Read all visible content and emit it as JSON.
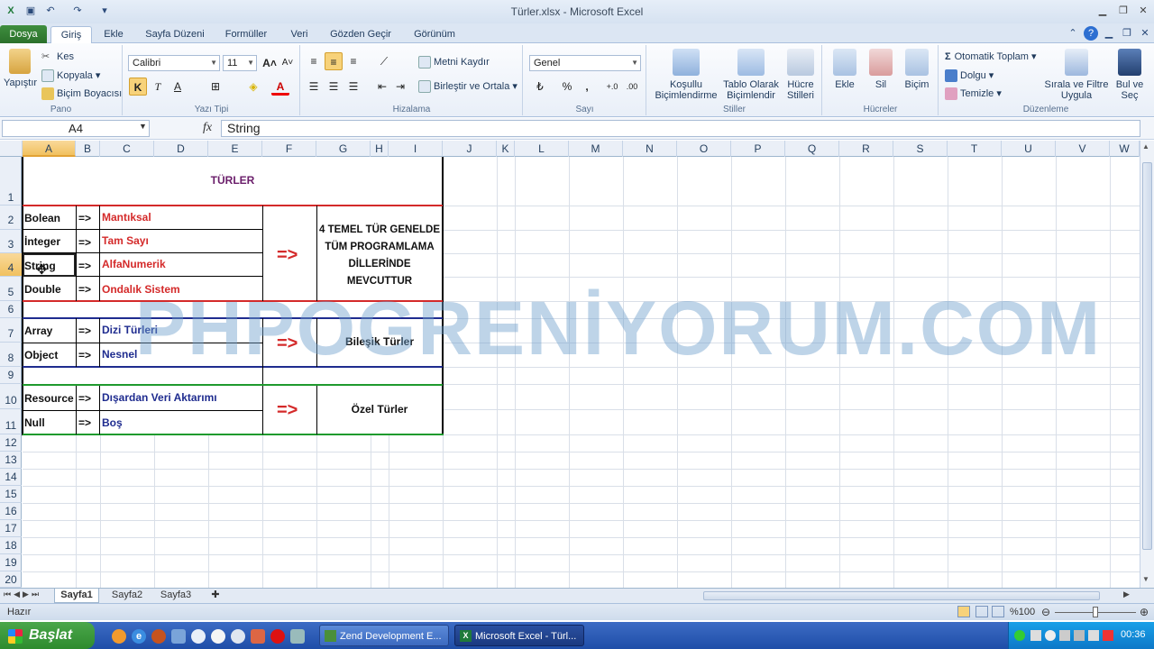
{
  "window": {
    "title": "Türler.xlsx - Microsoft Excel"
  },
  "ribbon_tabs": [
    "Dosya",
    "Giriş",
    "Ekle",
    "Sayfa Düzeni",
    "Formüller",
    "Veri",
    "Gözden Geçir",
    "Görünüm"
  ],
  "groups": {
    "pano": {
      "label": "Pano",
      "paste": "Yapıştır",
      "cut": "Kes",
      "copy": "Kopyala",
      "format_painter": "Biçim Boyacısı"
    },
    "font": {
      "label": "Yazı Tipi",
      "name": "Calibri",
      "size": "11",
      "bold": "K",
      "italic": "T",
      "underline": "A"
    },
    "align": {
      "label": "Hizalama",
      "wrap": "Metni Kaydır",
      "merge": "Birleştir ve Ortala"
    },
    "number": {
      "label": "Sayı",
      "format": "Genel",
      "percent": "%",
      "thousands": ","
    },
    "styles": {
      "label": "Stiller",
      "conditional": "Koşullu Biçimlendirme",
      "table": "Tablo Olarak Biçimlendir",
      "cell": "Hücre Stilleri"
    },
    "cells": {
      "label": "Hücreler",
      "insert": "Ekle",
      "delete": "Sil",
      "format": "Biçim"
    },
    "editing": {
      "label": "Düzenleme",
      "autosum": "Otomatik Toplam",
      "fill": "Dolgu",
      "clear": "Temizle",
      "sort": "Sırala ve Filtre Uygula",
      "find": "Bul ve Seç"
    }
  },
  "formula_bar": {
    "name_box": "A4",
    "fx": "fx",
    "value": "String"
  },
  "columns": [
    "A",
    "B",
    "C",
    "D",
    "E",
    "F",
    "G",
    "H",
    "I",
    "J",
    "K",
    "L",
    "M",
    "N",
    "O",
    "P",
    "Q",
    "R",
    "S",
    "T",
    "U",
    "V",
    "W"
  ],
  "rows": [
    "1",
    "2",
    "3",
    "4",
    "5",
    "6",
    "7",
    "8",
    "9",
    "10",
    "11",
    "12",
    "13",
    "14",
    "15",
    "16",
    "17",
    "18",
    "19",
    "20"
  ],
  "cells": {
    "title": "TÜRLER",
    "types": [
      {
        "name": "Bolean",
        "arrow": "=>",
        "desc": "Mantıksal"
      },
      {
        "name": "İnteger",
        "arrow": "=>",
        "desc": "Tam Sayı"
      },
      {
        "name": "String",
        "arrow": "=>",
        "desc": "AlfaNumerik"
      },
      {
        "name": "Double",
        "arrow": "=>",
        "desc": "Ondalık Sistem"
      },
      {
        "name": "Array",
        "arrow": "=>",
        "desc": "Dizi Türleri"
      },
      {
        "name": "Object",
        "arrow": "=>",
        "desc": "Nesnel"
      },
      {
        "name": "Resource",
        "arrow": "=>",
        "desc": "Dışardan Veri Aktarımı"
      },
      {
        "name": "Null",
        "arrow": "=>",
        "desc": "Boş"
      }
    ],
    "big_arrow": "=>",
    "group1": "4 TEMEL TÜR GENELDE TÜM PROGRAMLAMA DİLLERİNDE MEVCUTTUR",
    "group2": "Bileşik Türler",
    "group3": "Özel Türler"
  },
  "watermark": "PHPOGRENİYORUM.COM",
  "sheets": [
    "Sayfa1",
    "Sayfa2",
    "Sayfa3"
  ],
  "status": {
    "ready": "Hazır",
    "zoom": "%100"
  },
  "taskbar": {
    "start": "Başlat",
    "tasks": [
      "Zend Development E...",
      "Microsoft Excel - Türl..."
    ],
    "clock": "00:36"
  },
  "colors": {
    "red": "#d42a2a",
    "navy": "#1f2c8f",
    "green": "#1f9a2e",
    "purple": "#6a1d6a",
    "excel_green": "#2a6f2a"
  }
}
